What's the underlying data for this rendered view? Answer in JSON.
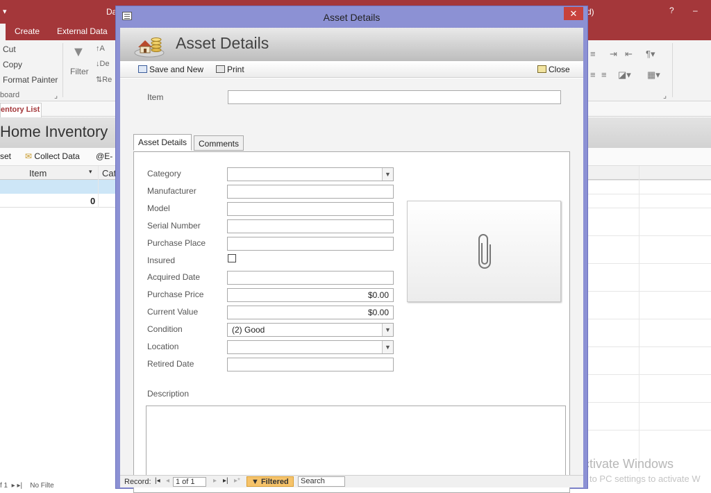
{
  "app": {
    "menu_glyph": "▾",
    "title_partial": "Da",
    "title_right_partial": "d)",
    "help": "?",
    "minimize": "–"
  },
  "ribbon": {
    "tabs": [
      "Create",
      "External Data"
    ],
    "clipboard": {
      "cut": "Cut",
      "copy": "Copy",
      "format_painter": "Format Painter",
      "group_label": "board"
    },
    "sort_filter": {
      "filter": "Filter",
      "ascending_partial": "A",
      "descending_partial": "De",
      "remove_partial": "Re"
    }
  },
  "nav": {
    "doc_tab": "entory List"
  },
  "bg_form": {
    "title": "Home Inventory",
    "toolbar": {
      "asset_partial": "set",
      "collect_data": "Collect Data",
      "email_partial": "E-"
    },
    "grid": {
      "columns": [
        "Item",
        "Cat"
      ],
      "total": "0"
    },
    "status_partial": "f 1",
    "status_filter_partial": "No Filte"
  },
  "watermark": {
    "line1": "Activate Windows",
    "line2": "Go to PC settings to activate W"
  },
  "dialog": {
    "title": "Asset Details",
    "close_glyph": "✕",
    "header_title": "Asset Details",
    "commands": {
      "save_and_new": "Save and New",
      "print": "Print",
      "close": "Close"
    },
    "item_label": "Item",
    "item_value": "",
    "tabs": [
      "Asset Details",
      "Comments"
    ],
    "fields": {
      "category": {
        "label": "Category",
        "value": ""
      },
      "manufacturer": {
        "label": "Manufacturer",
        "value": ""
      },
      "model": {
        "label": "Model",
        "value": ""
      },
      "serial_number": {
        "label": "Serial Number",
        "value": ""
      },
      "purchase_place": {
        "label": "Purchase Place",
        "value": ""
      },
      "insured": {
        "label": "Insured",
        "checked": false
      },
      "acquired_date": {
        "label": "Acquired Date",
        "value": ""
      },
      "purchase_price": {
        "label": "Purchase Price",
        "value": "$0.00"
      },
      "current_value": {
        "label": "Current Value",
        "value": "$0.00"
      },
      "condition": {
        "label": "Condition",
        "value": "(2) Good"
      },
      "location": {
        "label": "Location",
        "value": ""
      },
      "retired_date": {
        "label": "Retired Date",
        "value": ""
      }
    },
    "description_label": "Description",
    "record_nav": {
      "label": "Record:",
      "position": "1 of 1",
      "filtered": "Filtered",
      "search": "Search"
    }
  },
  "icons": {
    "attachment": "paperclip-icon",
    "save_and_new": "save-new-icon",
    "print": "printer-icon",
    "close": "close-form-icon",
    "dropdown": "chevron-down-icon"
  },
  "colors": {
    "access_red": "#a4373a",
    "dialog_frame": "#8c91d4",
    "close_button": "#c7423c",
    "filtered_badge": "#f6c36a",
    "selected_row": "#cde6f7"
  }
}
